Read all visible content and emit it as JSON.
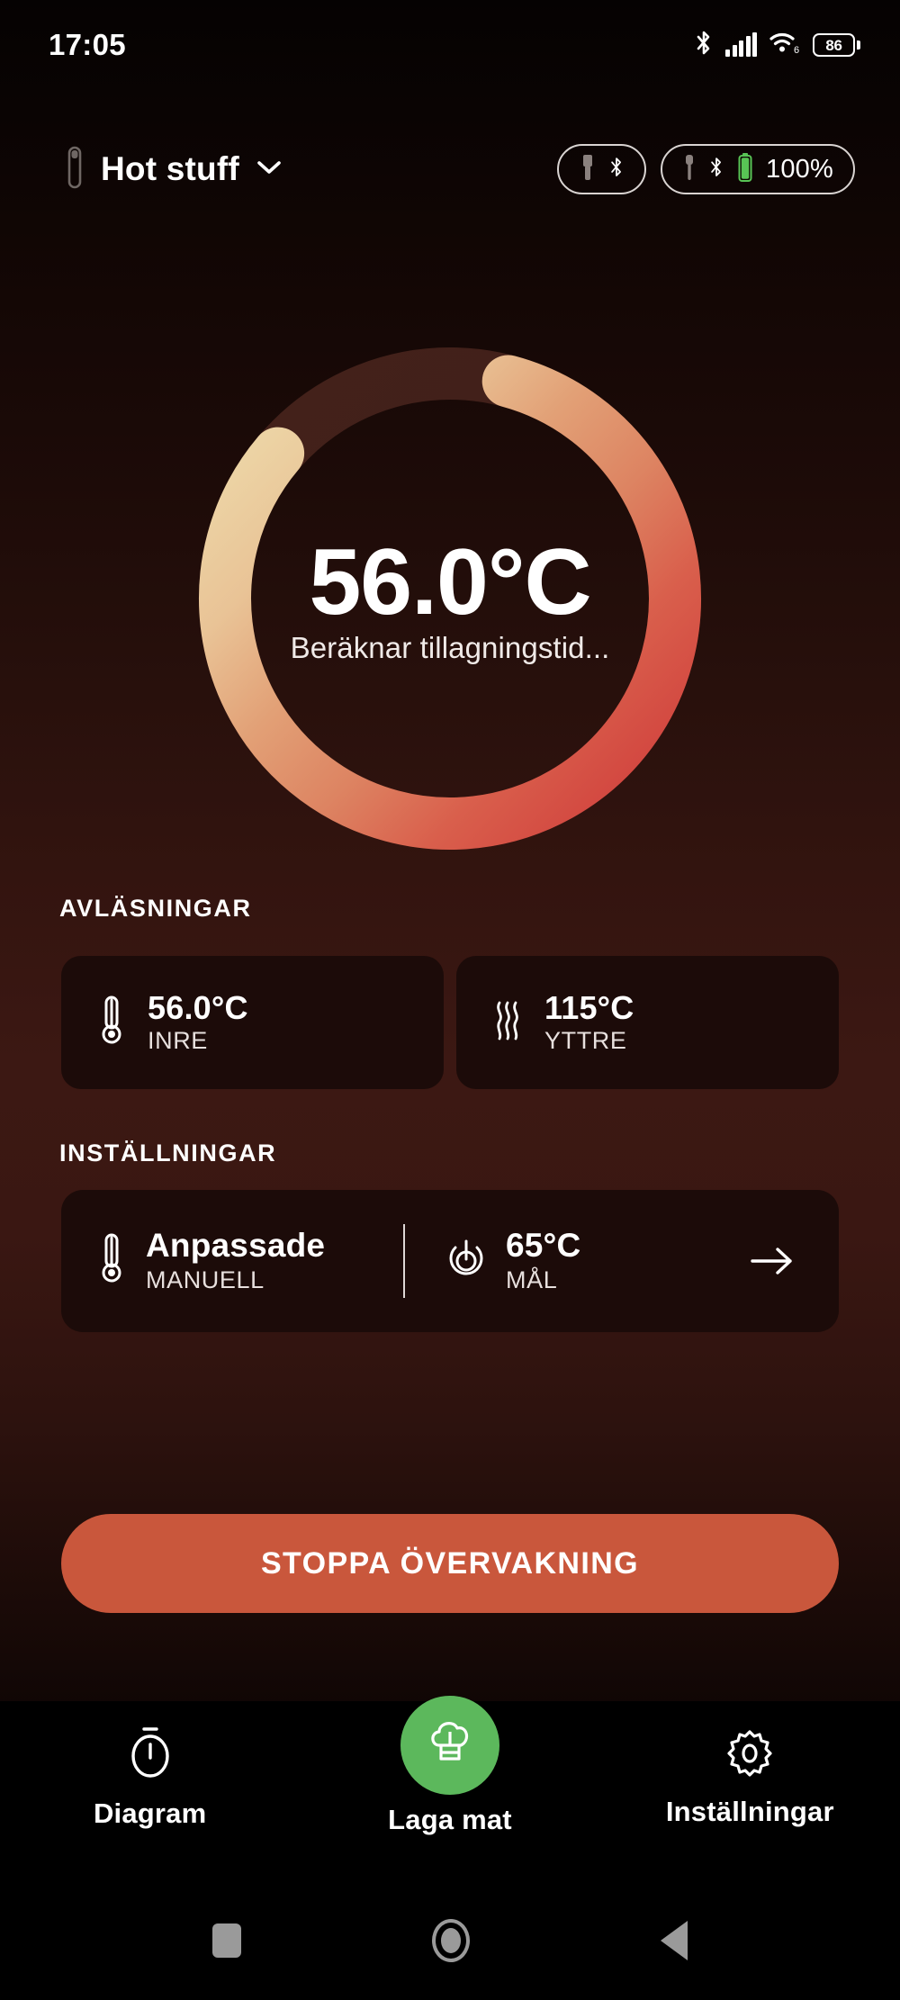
{
  "status_bar": {
    "time": "17:05",
    "bluetooth_icon": "bluetooth-icon",
    "signal_icon": "cellular-signal-icon",
    "wifi_icon": "wifi-6-icon",
    "wifi_generation": "6",
    "battery_icon": "battery-icon",
    "battery_percent": "86"
  },
  "header": {
    "probe_icon": "probe-icon",
    "title": "Hot stuff",
    "chevron_icon": "chevron-down-icon",
    "pills": [
      {
        "name": "charger-pill",
        "icons": [
          "charger-icon",
          "bluetooth-icon"
        ],
        "label": ""
      },
      {
        "name": "probe-battery-pill",
        "icons": [
          "probe-icon",
          "bluetooth-icon",
          "battery-icon"
        ],
        "label": "100%"
      }
    ]
  },
  "gauge": {
    "temperature": "56.0°C",
    "status": "Beräknar tillagningstid...",
    "track_color": "#3d1c15",
    "arc_start_color": "#ecd3a4",
    "arc_mid_color": "#e08a62",
    "arc_end_color": "#d9483f",
    "progress_percent": 82
  },
  "readings": {
    "section_label": "AVLÄSNINGAR",
    "cards": [
      {
        "name": "reading-card-internal",
        "icon": "thermometer-icon",
        "value": "56.0°C",
        "label": "INRE"
      },
      {
        "name": "reading-card-ambient",
        "icon": "heat-waves-icon",
        "value": "115°C",
        "label": "YTTRE"
      }
    ]
  },
  "settings": {
    "section_label": "INSTÄLLNINGAR",
    "mode": {
      "icon": "thermometer-icon",
      "value": "Anpassade",
      "label": "MANUELL"
    },
    "target": {
      "icon": "target-temperature-icon",
      "value": "65°C",
      "label": "MÅL"
    },
    "arrow_icon": "arrow-right-icon"
  },
  "primary_action": {
    "label": "STOPPA ÖVERVAKNING",
    "color": "#c9573c"
  },
  "bottom_nav": {
    "items": [
      {
        "name": "nav-item-chart",
        "icon": "timer-icon",
        "label": "Diagram"
      },
      {
        "name": "nav-item-cook",
        "icon": "chef-hat-icon",
        "label": "Laga mat",
        "active": true,
        "accent": "#5cb85c"
      },
      {
        "name": "nav-item-settings",
        "icon": "gear-icon",
        "label": "Inställningar"
      }
    ]
  },
  "system_nav": {
    "recents_icon": "square-recents-icon",
    "home_icon": "circle-home-icon",
    "back_icon": "triangle-back-icon"
  }
}
